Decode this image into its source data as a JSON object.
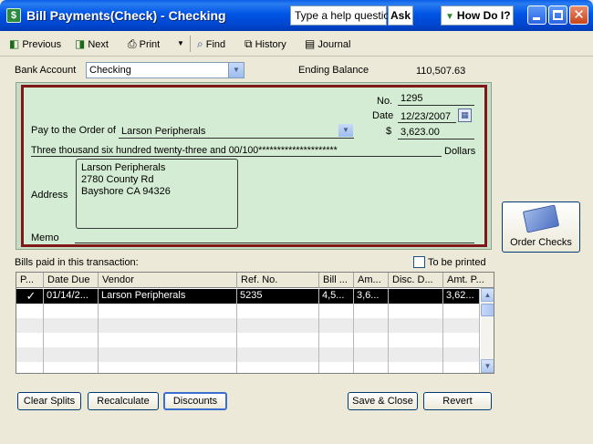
{
  "window": {
    "title": "Bill Payments(Check) - Checking",
    "help_placeholder": "Type a help question",
    "ask_label": "Ask",
    "howdoi_label": "How Do I?"
  },
  "toolbar": {
    "previous": "Previous",
    "next": "Next",
    "print": "Print",
    "find": "Find",
    "history": "History",
    "journal": "Journal"
  },
  "header": {
    "bank_account_label": "Bank Account",
    "bank_account_value": "Checking",
    "ending_balance_label": "Ending Balance",
    "ending_balance_value": "110,507.63"
  },
  "check": {
    "no_label": "No.",
    "no_value": "1295",
    "date_label": "Date",
    "date_value": "12/23/2007",
    "pay_to_label": "Pay to the Order of",
    "payee": "Larson Peripherals",
    "amount_symbol": "$",
    "amount": "3,623.00",
    "amount_words": "Three thousand six hundred twenty-three and 00/100*********************",
    "dollars_label": "Dollars",
    "address_label": "Address",
    "address_lines": [
      "Larson Peripherals",
      "2780 County Rd",
      "Bayshore CA 94326"
    ],
    "memo_label": "Memo"
  },
  "order_checks_label": "Order Checks",
  "bills": {
    "label": "Bills paid in this transaction:",
    "to_be_printed_label": "To be printed",
    "columns": [
      "P...",
      "Date Due",
      "Vendor",
      "Ref. No.",
      "Bill ...",
      "Am...",
      "Disc. D...",
      "Amt. P..."
    ],
    "rows": [
      {
        "check": "✓",
        "date_due": "01/14/2...",
        "vendor": "Larson Peripherals",
        "ref_no": "5235",
        "bill_amt": "4,5...",
        "amt_due": "3,6...",
        "disc_date": "",
        "amt_paid": "3,62..."
      }
    ]
  },
  "buttons": {
    "clear_splits": "Clear Splits",
    "recalculate": "Recalculate",
    "discounts": "Discounts",
    "save_close": "Save & Close",
    "revert": "Revert"
  }
}
